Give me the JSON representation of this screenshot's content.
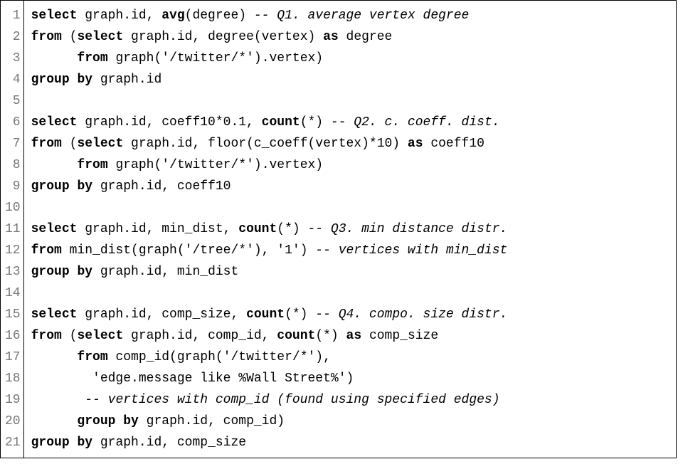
{
  "lines": [
    {
      "num": "1",
      "segments": [
        {
          "t": "select",
          "c": "kw"
        },
        {
          "t": " graph.id, "
        },
        {
          "t": "avg",
          "c": "kw"
        },
        {
          "t": "(degree) "
        },
        {
          "t": "-- Q1. average vertex degree",
          "c": "cm"
        }
      ]
    },
    {
      "num": "2",
      "segments": [
        {
          "t": "from",
          "c": "kw"
        },
        {
          "t": " ("
        },
        {
          "t": "select",
          "c": "kw"
        },
        {
          "t": " graph.id, degree(vertex) "
        },
        {
          "t": "as",
          "c": "kw"
        },
        {
          "t": " degree"
        }
      ]
    },
    {
      "num": "3",
      "segments": [
        {
          "t": "      "
        },
        {
          "t": "from",
          "c": "kw"
        },
        {
          "t": " graph("
        },
        {
          "t": "'/twitter/*'",
          "c": "str"
        },
        {
          "t": ").vertex)"
        }
      ]
    },
    {
      "num": "4",
      "segments": [
        {
          "t": "group",
          "c": "kw"
        },
        {
          "t": " "
        },
        {
          "t": "by",
          "c": "kw"
        },
        {
          "t": " graph.id"
        }
      ]
    },
    {
      "num": "5",
      "segments": [
        {
          "t": " "
        }
      ]
    },
    {
      "num": "6",
      "segments": [
        {
          "t": "select",
          "c": "kw"
        },
        {
          "t": " graph.id, coeff10*0.1, "
        },
        {
          "t": "count",
          "c": "kw"
        },
        {
          "t": "(*) "
        },
        {
          "t": "-- Q2. c. coeff. dist.",
          "c": "cm"
        }
      ]
    },
    {
      "num": "7",
      "segments": [
        {
          "t": "from",
          "c": "kw"
        },
        {
          "t": " ("
        },
        {
          "t": "select",
          "c": "kw"
        },
        {
          "t": " graph.id, floor(c_coeff(vertex)*10) "
        },
        {
          "t": "as",
          "c": "kw"
        },
        {
          "t": " coeff10"
        }
      ]
    },
    {
      "num": "8",
      "segments": [
        {
          "t": "      "
        },
        {
          "t": "from",
          "c": "kw"
        },
        {
          "t": " graph("
        },
        {
          "t": "'/twitter/*'",
          "c": "str"
        },
        {
          "t": ").vertex)"
        }
      ]
    },
    {
      "num": "9",
      "segments": [
        {
          "t": "group",
          "c": "kw"
        },
        {
          "t": " "
        },
        {
          "t": "by",
          "c": "kw"
        },
        {
          "t": " graph.id, coeff10"
        }
      ]
    },
    {
      "num": "10",
      "segments": [
        {
          "t": " "
        }
      ]
    },
    {
      "num": "11",
      "segments": [
        {
          "t": "select",
          "c": "kw"
        },
        {
          "t": " graph.id, min_dist, "
        },
        {
          "t": "count",
          "c": "kw"
        },
        {
          "t": "(*) "
        },
        {
          "t": "-- Q3. min distance distr.",
          "c": "cm"
        }
      ]
    },
    {
      "num": "12",
      "segments": [
        {
          "t": "from",
          "c": "kw"
        },
        {
          "t": " min_dist(graph("
        },
        {
          "t": "'/tree/*'",
          "c": "str"
        },
        {
          "t": "), "
        },
        {
          "t": "'1'",
          "c": "str"
        },
        {
          "t": ") "
        },
        {
          "t": "-- vertices with min_dist",
          "c": "cm"
        }
      ]
    },
    {
      "num": "13",
      "segments": [
        {
          "t": "group",
          "c": "kw"
        },
        {
          "t": " "
        },
        {
          "t": "by",
          "c": "kw"
        },
        {
          "t": " graph.id, min_dist"
        }
      ]
    },
    {
      "num": "14",
      "segments": [
        {
          "t": " "
        }
      ]
    },
    {
      "num": "15",
      "segments": [
        {
          "t": "select",
          "c": "kw"
        },
        {
          "t": " graph.id, comp_size, "
        },
        {
          "t": "count",
          "c": "kw"
        },
        {
          "t": "(*) "
        },
        {
          "t": "-- Q4. compo. size distr.",
          "c": "cm"
        }
      ]
    },
    {
      "num": "16",
      "segments": [
        {
          "t": "from",
          "c": "kw"
        },
        {
          "t": " ("
        },
        {
          "t": "select",
          "c": "kw"
        },
        {
          "t": " graph.id, comp_id, "
        },
        {
          "t": "count",
          "c": "kw"
        },
        {
          "t": "(*) "
        },
        {
          "t": "as",
          "c": "kw"
        },
        {
          "t": " comp_size"
        }
      ]
    },
    {
      "num": "17",
      "segments": [
        {
          "t": "      "
        },
        {
          "t": "from",
          "c": "kw"
        },
        {
          "t": " comp_id(graph("
        },
        {
          "t": "'/twitter/*'",
          "c": "str"
        },
        {
          "t": "),"
        }
      ]
    },
    {
      "num": "18",
      "segments": [
        {
          "t": "        "
        },
        {
          "t": "'edge.message like %Wall Street%'",
          "c": "str"
        },
        {
          "t": ")"
        }
      ]
    },
    {
      "num": "19",
      "segments": [
        {
          "t": "       "
        },
        {
          "t": "-- vertices with comp_id (found using specified edges)",
          "c": "cm"
        }
      ]
    },
    {
      "num": "20",
      "segments": [
        {
          "t": "      "
        },
        {
          "t": "group",
          "c": "kw"
        },
        {
          "t": " "
        },
        {
          "t": "by",
          "c": "kw"
        },
        {
          "t": " graph.id, comp_id)"
        }
      ]
    },
    {
      "num": "21",
      "segments": [
        {
          "t": "group",
          "c": "kw"
        },
        {
          "t": " "
        },
        {
          "t": "by",
          "c": "kw"
        },
        {
          "t": " graph.id, comp_size"
        }
      ]
    }
  ]
}
